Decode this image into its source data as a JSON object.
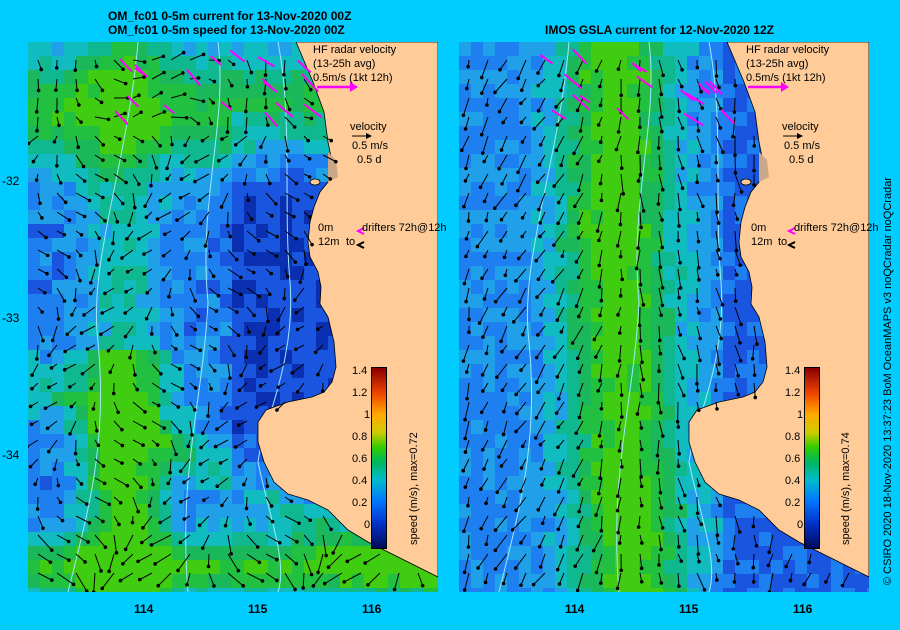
{
  "left_panel": {
    "title_line1": "OM_fc01 0-5m current for 13-Nov-2020 00Z",
    "title_line2": "OM_fc01 0-5m speed for 13-Nov-2020 00Z"
  },
  "right_panel": {
    "title": "IMOS GSLA current for 12-Nov-2020 12Z"
  },
  "legend": {
    "hf_line1": "HF radar velocity",
    "hf_line2": "(13-25h avg)",
    "hf_line3": "0.5m/s (1kt 12h)",
    "velocity_line1": "velocity",
    "velocity_line2": "0.5 m/s",
    "velocity_line3": "0.5 d",
    "drifters_0m": "0m",
    "drifters_label": "drifters 72h@12h",
    "drifters_12m": "12m",
    "drifters_to": "to"
  },
  "axes": {
    "lat_ticks": [
      "-32",
      "-33",
      "-34"
    ],
    "lon_ticks": [
      "114",
      "115",
      "116"
    ]
  },
  "colorbar": {
    "label_left": "speed (m/s), max=0.72",
    "label_right": "speed (m/s), max=0.74",
    "ticks": [
      "1.4",
      "1.2",
      "1",
      "0.8",
      "0.6",
      "0.4",
      "0.2",
      "0"
    ],
    "max_left": 0.72,
    "max_right": 0.74
  },
  "credit": "© CSIRO 2020    18-Nov-2020 13:37:23 BoM OceanMAPS v3 noQCradar noQCradar",
  "colors": {
    "background": "#00ccff",
    "land": "#ffcc99",
    "hf_arrow": "#ff00ff"
  }
}
